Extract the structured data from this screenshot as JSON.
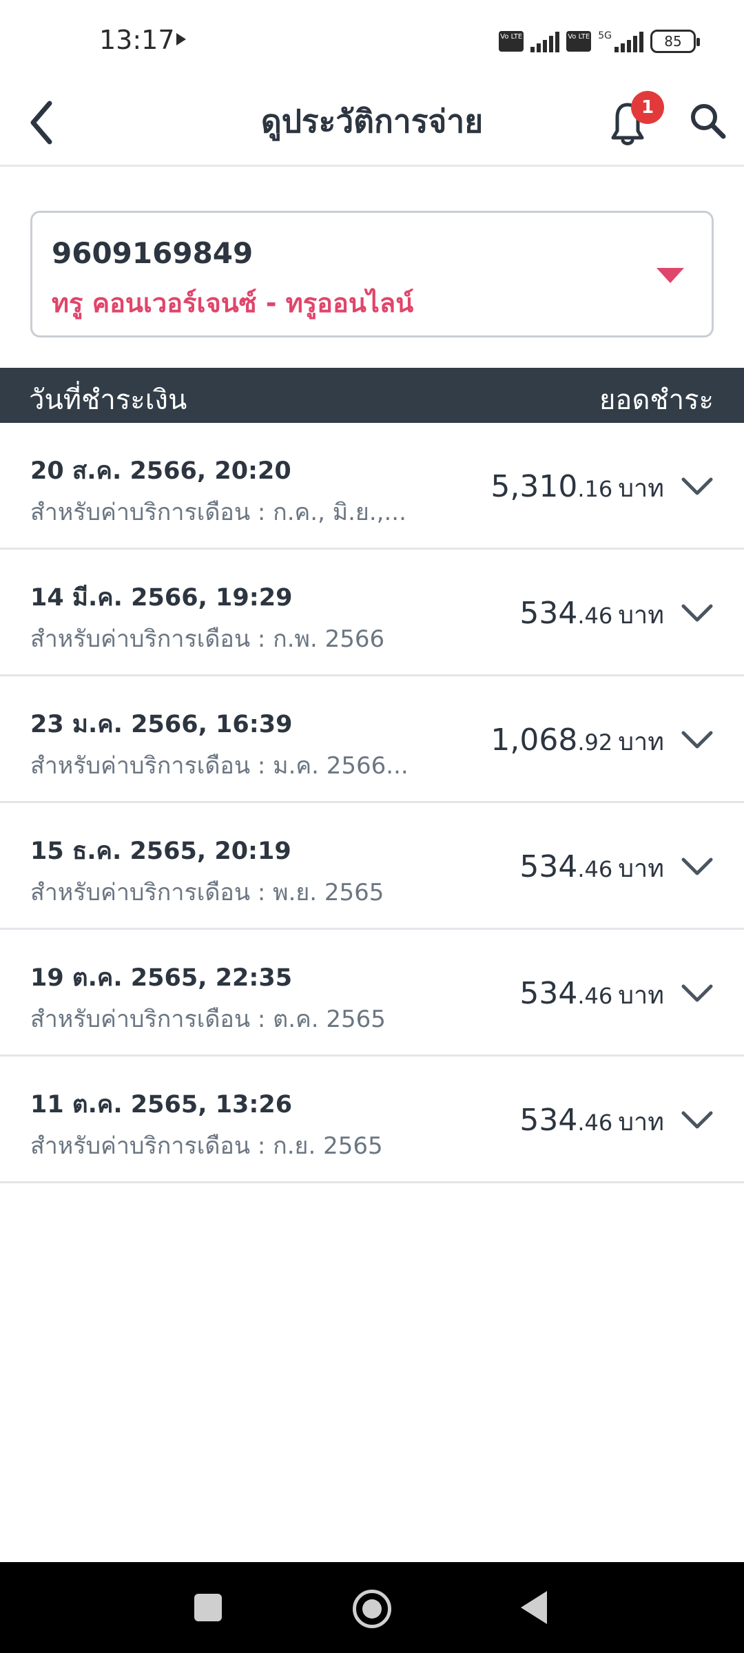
{
  "status_bar": {
    "time": "13:17",
    "network_label": "5G",
    "volte_label": "Vo LTE",
    "battery": "85"
  },
  "header": {
    "title": "ดูประวัติการจ่าย",
    "notification_count": "1",
    "icons": [
      "back-arrow-icon",
      "bell-icon",
      "search-icon"
    ]
  },
  "account": {
    "number": "9609169849",
    "name": "ทรู คอนเวอร์เจนซ์ - ทรูออนไลน์"
  },
  "table": {
    "date_header": "วันที่ชำระเงิน",
    "amount_header": "ยอดชำระ",
    "rows": [
      {
        "date": "20 ส.ค. 2566, 20:20",
        "desc": "สำหรับค่าบริการเดือน : ก.ค., มิ.ย.,...",
        "amount_int": "5,310",
        "amount_dec": ".16",
        "unit": "บาท"
      },
      {
        "date": "14 มี.ค. 2566, 19:29",
        "desc": "สำหรับค่าบริการเดือน : ก.พ. 2566",
        "amount_int": "534",
        "amount_dec": ".46",
        "unit": "บาท"
      },
      {
        "date": "23 ม.ค. 2566, 16:39",
        "desc": "สำหรับค่าบริการเดือน : ม.ค. 2566...",
        "amount_int": "1,068",
        "amount_dec": ".92",
        "unit": "บาท"
      },
      {
        "date": "15 ธ.ค. 2565, 20:19",
        "desc": "สำหรับค่าบริการเดือน : พ.ย. 2565",
        "amount_int": "534",
        "amount_dec": ".46",
        "unit": "บาท"
      },
      {
        "date": "19 ต.ค. 2565, 22:35",
        "desc": "สำหรับค่าบริการเดือน : ต.ค. 2565",
        "amount_int": "534",
        "amount_dec": ".46",
        "unit": "บาท"
      },
      {
        "date": "11 ต.ค. 2565, 13:26",
        "desc": "สำหรับค่าบริการเดือน : ก.ย. 2565",
        "amount_int": "534",
        "amount_dec": ".46",
        "unit": "บาท"
      }
    ]
  },
  "colors": {
    "accent": "#e0456a",
    "table_header_bg": "#323d47",
    "badge": "#e23a3a"
  }
}
